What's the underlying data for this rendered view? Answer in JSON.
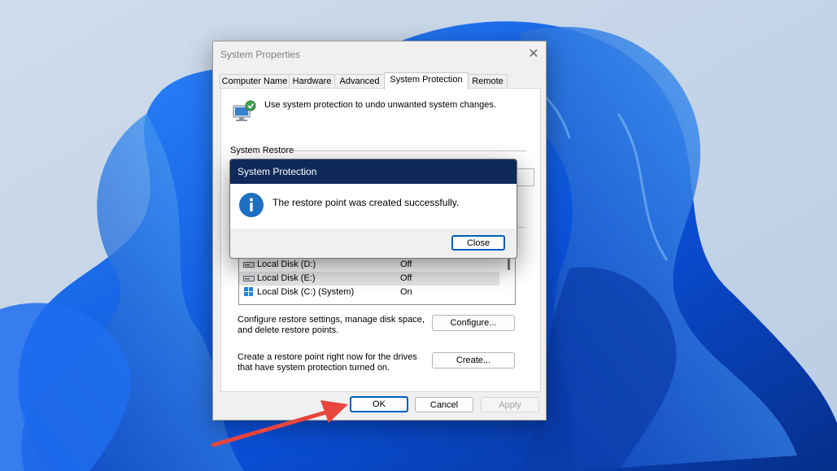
{
  "window": {
    "title": "System Properties",
    "close_glyph": "✕",
    "tabs": [
      "Computer Name",
      "Hardware",
      "Advanced",
      "System Protection",
      "Remote"
    ],
    "active_tab": "System Protection"
  },
  "panel": {
    "intro": "Use system protection to undo unwanted system changes.",
    "section_title": "System Restore",
    "drives": [
      {
        "name": "Local Disk (D:)",
        "status": "Off"
      },
      {
        "name": "Local Disk (E:)",
        "status": "Off"
      },
      {
        "name": "Local Disk (C:) (System)",
        "status": "On"
      }
    ],
    "configure_text": "Configure restore settings, manage disk space, and delete restore points.",
    "configure_button": "Configure...",
    "create_text": "Create a restore point right now for the drives that have system protection turned on.",
    "create_button": "Create..."
  },
  "footer": {
    "ok": "OK",
    "cancel": "Cancel",
    "apply": "Apply"
  },
  "dialog": {
    "title": "System Protection",
    "message": "The restore point was created successfully.",
    "close_button": "Close",
    "icon": "info-icon"
  },
  "colors": {
    "dialog_title_bar": "#0f2a5a",
    "accent": "#005fb8",
    "info_icon": "#1e6fc0",
    "arrow": "#e8453c"
  }
}
